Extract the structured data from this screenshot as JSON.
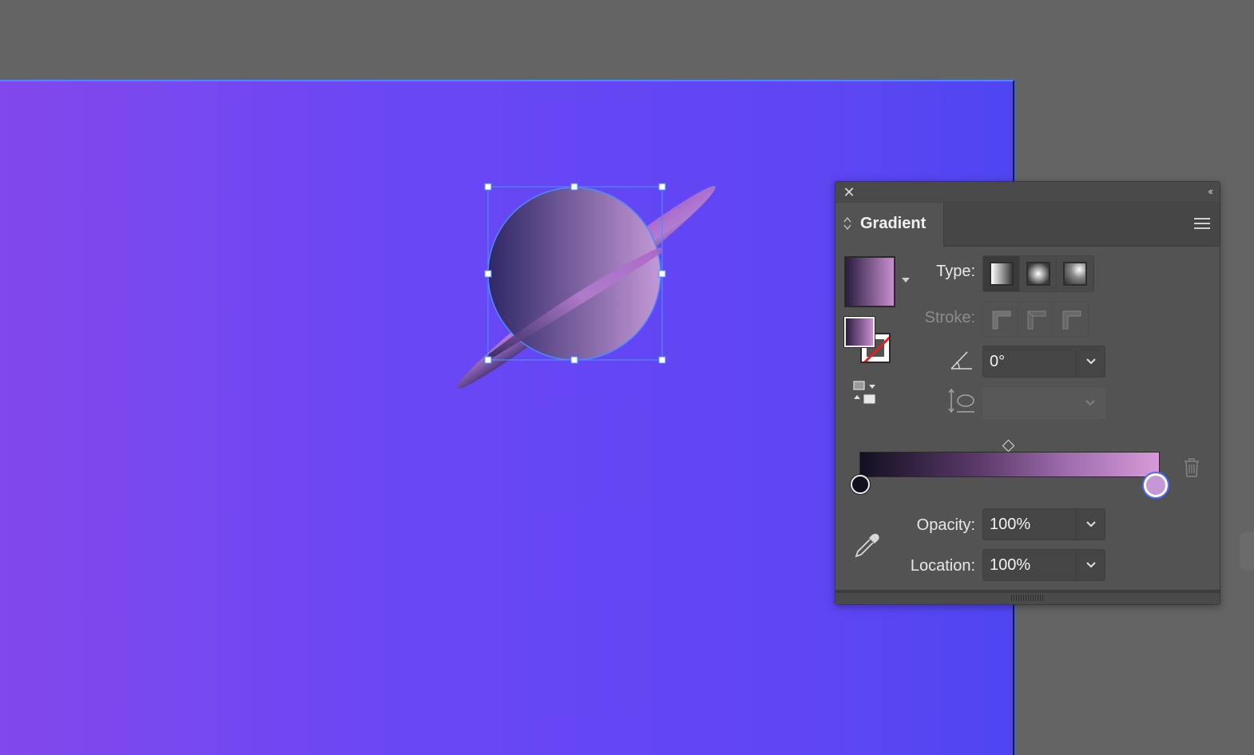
{
  "canvas": {
    "background_color": "#646464",
    "artboard_gradient": [
      "#8148ec",
      "#6a47f4",
      "#4f45f2"
    ],
    "selection_color": "#4a8cff"
  },
  "artwork": {
    "object": "planet",
    "fill_gradient": [
      "#2f2766",
      "#c498d6"
    ]
  },
  "panel": {
    "close_icon": "close-icon",
    "collapse_icon": "double-chevron-left-icon",
    "tab_title": "Gradient",
    "menu_icon": "hamburger-menu-icon",
    "type_label": "Type:",
    "type_options": [
      "linear-gradient-icon",
      "radial-gradient-icon",
      "freeform-gradient-icon"
    ],
    "type_selected": "linear",
    "stroke_label": "Stroke:",
    "stroke_options": [
      "stroke-within-icon",
      "stroke-along-icon",
      "stroke-across-icon"
    ],
    "angle_value": "0°",
    "aspect_value": "",
    "gradient_colors": [
      "#131022",
      "#d79ad8"
    ],
    "stops": [
      {
        "location": 0,
        "color": "#12101e"
      },
      {
        "location": 100,
        "color": "#c597d4",
        "selected": true
      }
    ],
    "midpoint": 50,
    "opacity_label": "Opacity:",
    "opacity_value": "100%",
    "location_label": "Location:",
    "location_value": "100%"
  }
}
